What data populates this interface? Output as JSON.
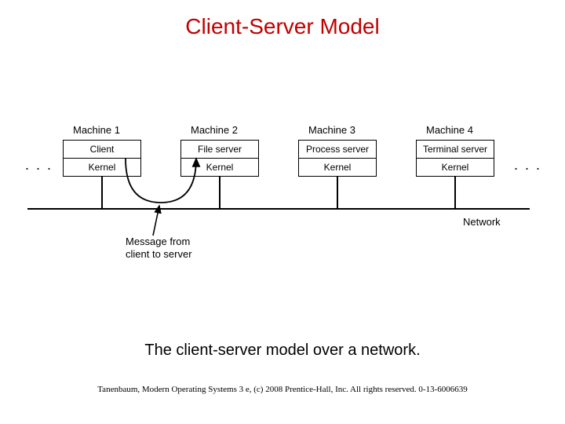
{
  "title": "Client-Server Model",
  "caption": "The client-server model over a network.",
  "credit": "Tanenbaum, Modern Operating Systems 3 e, (c) 2008 Prentice-Hall, Inc. All rights reserved. 0-13-6006639",
  "dots": ". . .",
  "network_label": "Network",
  "message_label_line1": "Message from",
  "message_label_line2": "client to server",
  "machines": [
    {
      "name": "Machine 1",
      "top": "Client",
      "bottom": "Kernel"
    },
    {
      "name": "Machine 2",
      "top": "File server",
      "bottom": "Kernel"
    },
    {
      "name": "Machine 3",
      "top": "Process server",
      "bottom": "Kernel"
    },
    {
      "name": "Machine 4",
      "top": "Terminal server",
      "bottom": "Kernel"
    }
  ],
  "colors": {
    "title": "#c00000"
  }
}
